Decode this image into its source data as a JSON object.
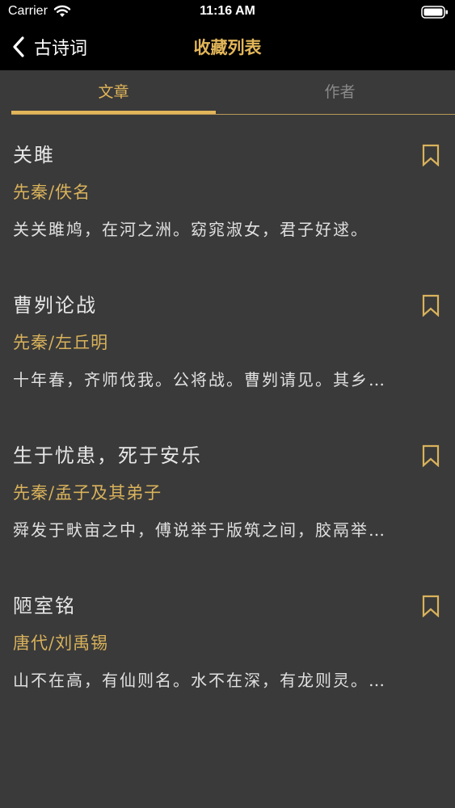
{
  "status_bar": {
    "carrier": "Carrier",
    "time": "11:16 AM"
  },
  "nav": {
    "back_label": "古诗词",
    "title": "收藏列表"
  },
  "tabs": [
    {
      "label": "文章",
      "active": true
    },
    {
      "label": "作者",
      "active": false
    }
  ],
  "colors": {
    "accent": "#e2b659",
    "background": "#3a3a3a",
    "nav_background": "#000000"
  },
  "poems": [
    {
      "title": "关雎",
      "author": "先秦/佚名",
      "excerpt": "关关雎鸠，在河之洲。窈窕淑女，君子好逑。"
    },
    {
      "title": "曹刿论战",
      "author": "先秦/左丘明",
      "excerpt": "十年春，齐师伐我。公将战。曹刿请见。其乡…"
    },
    {
      "title": "生于忧患，死于安乐",
      "author": "先秦/孟子及其弟子",
      "excerpt": "舜发于畎亩之中，傅说举于版筑之间，胶鬲举…"
    },
    {
      "title": "陋室铭",
      "author": "唐代/刘禹锡",
      "excerpt": "山不在高，有仙则名。水不在深，有龙则灵。…"
    }
  ],
  "icons": {
    "back": "chevron-left-icon",
    "bookmark": "bookmark-icon",
    "wifi": "wifi-icon",
    "battery": "battery-icon"
  }
}
